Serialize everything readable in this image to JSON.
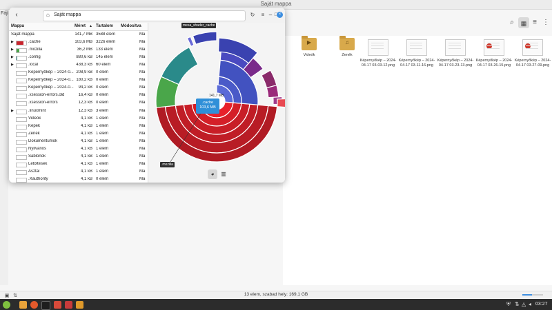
{
  "desktop": {
    "title": "Saját mappa",
    "files_label": "Fájl",
    "status": "13 elem, szabad hely: 169,1 GB",
    "grid_items": [
      {
        "label": "Videók",
        "kind": "folder",
        "glyph": "▶"
      },
      {
        "label": "Zenék",
        "kind": "folder",
        "glyph": "♫"
      },
      {
        "label": "Képernyőkép – 2024-04-17 03-03-12.png",
        "kind": "thumb"
      },
      {
        "label": "Képernyőkép – 2024-04-17 03-11-16.png",
        "kind": "thumb"
      },
      {
        "label": "Képernyőkép – 2024-04-17 03-23-13.png",
        "kind": "thumb"
      },
      {
        "label": "Képernyőkép – 2024-04-17 03-26-15.png",
        "kind": "thumb-red"
      },
      {
        "label": "Képernyőkép – 2024-04-17 03-27-09.png",
        "kind": "thumb-red"
      }
    ]
  },
  "taskbar": {
    "time": "03:27"
  },
  "disk_usage": {
    "path": "Saját mappa",
    "columns": {
      "name": "Mappa",
      "size": "Méret",
      "count": "Tartalom",
      "modified": "Módosítva"
    },
    "rows": [
      {
        "name": "Saját mappa",
        "size": "141,7 MB",
        "count": "3588 elem",
        "mod": "Ma",
        "root": true
      },
      {
        "name": ".cache",
        "size": "103,6 MB",
        "count": "3226 elem",
        "mod": "Ma",
        "expand": "▶",
        "pct": 73,
        "color": "#c8232c"
      },
      {
        "name": ".mozilla",
        "size": "36,2 MB",
        "count": "133 elem",
        "mod": "Ma",
        "expand": "▶",
        "pct": 26,
        "color": "#4aa64a"
      },
      {
        "name": ".config",
        "size": "880,6 kB",
        "count": "145 elem",
        "mod": "Ma",
        "expand": "▶",
        "pct": 1,
        "color": "#2a8a8a"
      },
      {
        "name": ".local",
        "size": "438,3 kB",
        "count": "60 elem",
        "mod": "Ma",
        "expand": "▶",
        "pct": 0.5,
        "color": "#5a5ad0"
      },
      {
        "name": "Képernyőkép – 2024-0...",
        "size": "208,9 kB",
        "count": "0 elem",
        "mod": "Ma"
      },
      {
        "name": "Képernyőkép – 2024-0...",
        "size": "180,2 kB",
        "count": "0 elem",
        "mod": "Ma"
      },
      {
        "name": "Képernyőkép – 2024-0...",
        "size": "94,2 kB",
        "count": "0 elem",
        "mod": "Ma"
      },
      {
        "name": ".xsession-errors.old",
        "size": "16,4 kB",
        "count": "0 elem",
        "mod": "Ma"
      },
      {
        "name": ".xsession-errors",
        "size": "12,3 kB",
        "count": "0 elem",
        "mod": "Ma"
      },
      {
        "name": ".linuxmint",
        "size": "12,3 kB",
        "count": "3 elem",
        "mod": "Ma",
        "expand": "▶"
      },
      {
        "name": "Videók",
        "size": "4,1 kB",
        "count": "1 elem",
        "mod": "Ma"
      },
      {
        "name": "Képek",
        "size": "4,1 kB",
        "count": "1 elem",
        "mod": "Ma"
      },
      {
        "name": "Zenék",
        "size": "4,1 kB",
        "count": "1 elem",
        "mod": "Ma"
      },
      {
        "name": "Dokumentumok",
        "size": "4,1 kB",
        "count": "1 elem",
        "mod": "Ma"
      },
      {
        "name": "Nyilvános",
        "size": "4,1 kB",
        "count": "1 elem",
        "mod": "Ma"
      },
      {
        "name": "Sablonok",
        "size": "4,1 kB",
        "count": "1 elem",
        "mod": "Ma"
      },
      {
        "name": "Letöltések",
        "size": "4,1 kB",
        "count": "1 elem",
        "mod": "Ma"
      },
      {
        "name": "Asztal",
        "size": "4,1 kB",
        "count": "1 elem",
        "mod": "Ma"
      },
      {
        "name": ".Xauthority",
        "size": "4,1 kB",
        "count": "0 elem",
        "mod": "Ma"
      }
    ],
    "chart": {
      "center_label": "141,7 MB",
      "selected_name": ".cache",
      "selected_size": "103,6 MB",
      "tooltip_top": "mesa_shader_cache",
      "tooltip_bottom": ".mozilla"
    }
  }
}
